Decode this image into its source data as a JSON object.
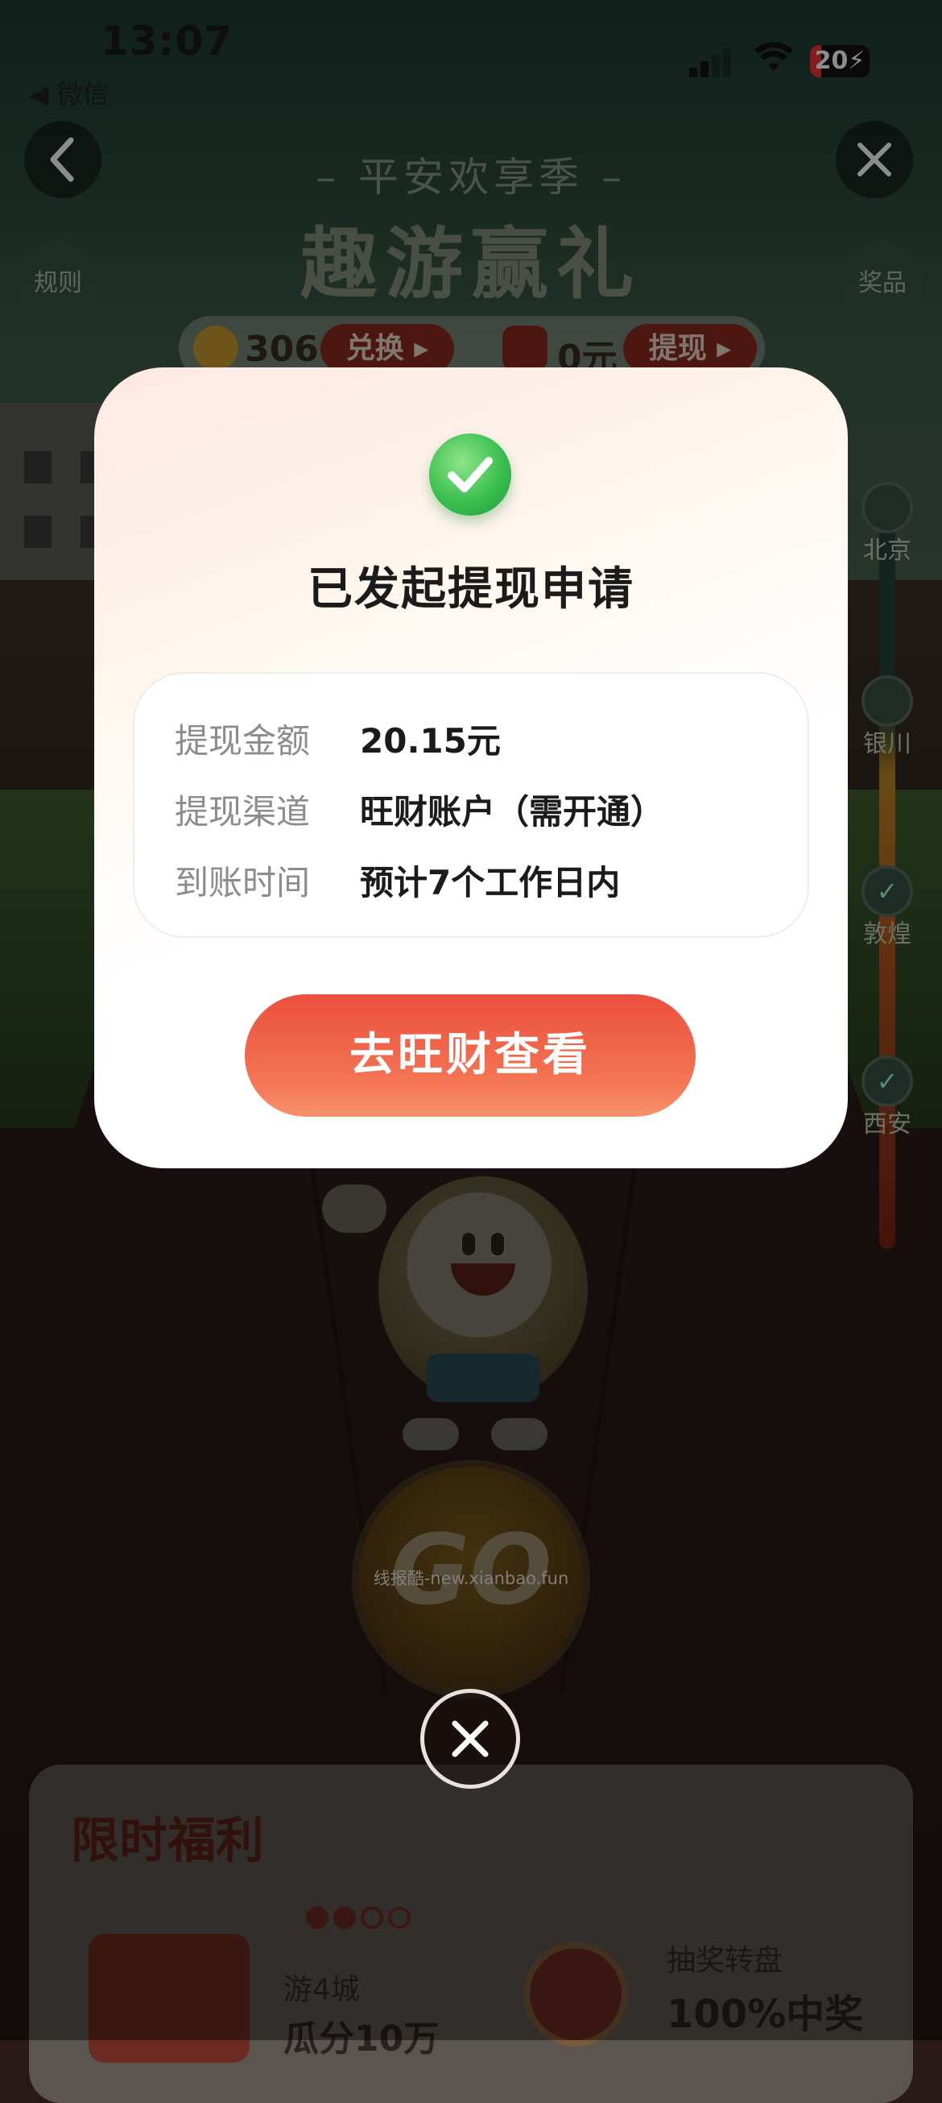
{
  "status_bar": {
    "time": "13:07",
    "back_app": "◀ 微信",
    "battery": "20"
  },
  "header": {
    "subtitle": "– 平安欢享季 –",
    "title": "趣游赢礼",
    "rules_label": "规则",
    "prizes_label": "奖品"
  },
  "coin_bar": {
    "coins": "306",
    "exchange_label": "兑换 ▸",
    "cash": "0元",
    "withdraw_label": "提现 ▸"
  },
  "route": {
    "cities": [
      "北京",
      "银川",
      "敦煌",
      "西安"
    ]
  },
  "modal": {
    "title": "已发起提现申请",
    "rows": [
      {
        "label": "提现金额",
        "value": "20.15元"
      },
      {
        "label": "提现渠道",
        "value": "旺财账户（需开通）"
      },
      {
        "label": "到账时间",
        "value": "预计7个工作日内"
      }
    ],
    "cta": "去旺财查看"
  },
  "game": {
    "go_label": "GO",
    "watermark": "线报酷-new.xianbao.fun"
  },
  "welfare": {
    "title": "限时福利",
    "item1_label": "游4城",
    "item1_value": "瓜分10万",
    "item2_label": "抽奖转盘",
    "item2_value": "100%中奖"
  },
  "colors": {
    "accent": "#ec4f3e",
    "success": "#3bbf4f"
  }
}
